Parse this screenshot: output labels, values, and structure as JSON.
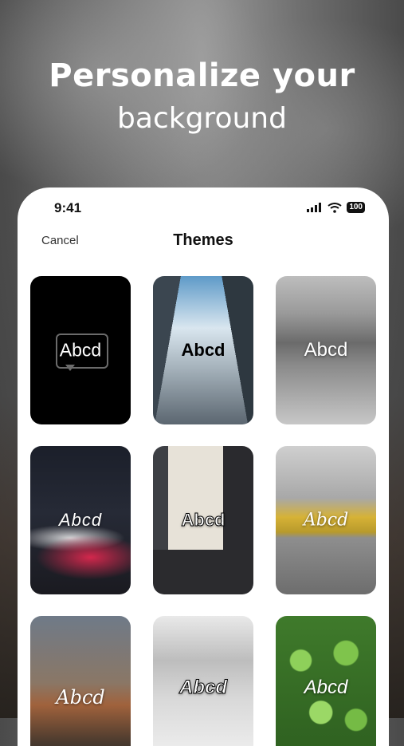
{
  "hero": {
    "title": "Personalize your",
    "subtitle": "background"
  },
  "status_bar": {
    "time": "9:41",
    "battery": "100"
  },
  "nav": {
    "cancel_label": "Cancel",
    "title": "Themes"
  },
  "themes": [
    {
      "label": "Abcd",
      "style": "chat"
    },
    {
      "label": "Abcd",
      "style": "bold-block"
    },
    {
      "label": "Abcd",
      "style": "rounded"
    },
    {
      "label": "Abcd",
      "style": "script"
    },
    {
      "label": "Abcd",
      "style": "outline"
    },
    {
      "label": "Abcd",
      "style": "script-italic"
    },
    {
      "label": "Abcd",
      "style": "script-italic"
    },
    {
      "label": "Abcd",
      "style": "outline-italic"
    },
    {
      "label": "Abcd",
      "style": "italic"
    }
  ],
  "colors": {
    "card_background": "#ffffff",
    "text_primary": "#111111"
  }
}
